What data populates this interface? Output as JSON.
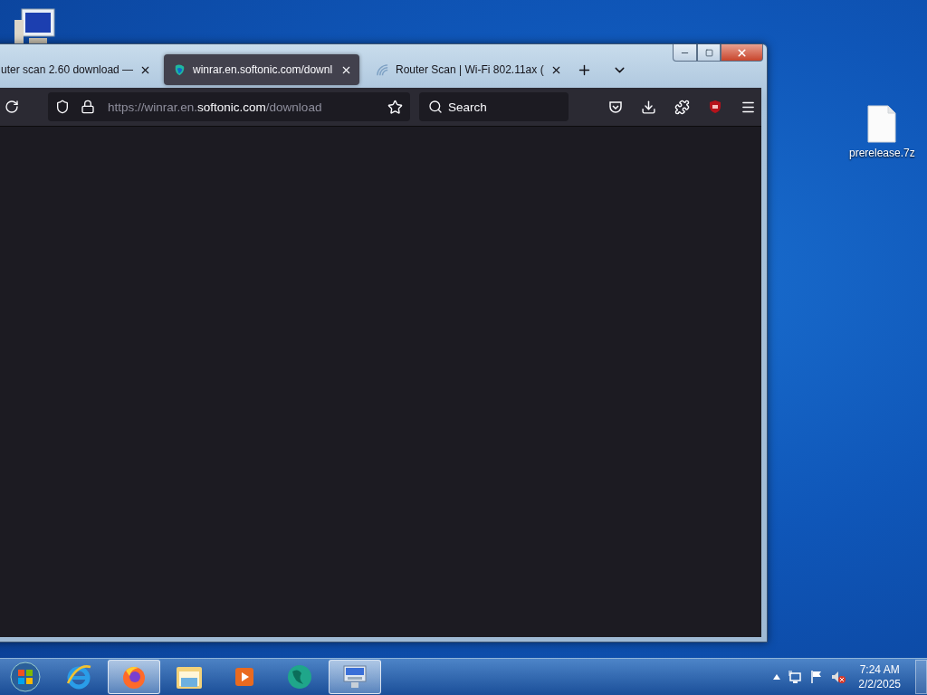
{
  "desktop_icons": [
    {
      "kind": "computer"
    },
    {
      "kind": "file",
      "label": "prerelease.7z"
    }
  ],
  "browser": {
    "tabs": [
      {
        "title": "uter scan 2.60 download —",
        "selected": false,
        "kind": "plain"
      },
      {
        "title": "winrar.en.softonic.com/downl",
        "selected": true,
        "kind": "softonic"
      },
      {
        "title": "Router Scan | Wi-Fi 802.11ax (",
        "selected": false,
        "kind": "wifi"
      }
    ],
    "address": {
      "parts": [
        {
          "text": "https://winrar.en.",
          "highlight": false
        },
        {
          "text": "softonic.com",
          "highlight": true
        },
        {
          "text": "/download",
          "highlight": false
        }
      ]
    },
    "search": {
      "placeholder": "Search"
    }
  },
  "taskbar": {
    "items": [
      {
        "kind": "ie",
        "active": false
      },
      {
        "kind": "firefox",
        "active": true
      },
      {
        "kind": "explorer",
        "active": false
      },
      {
        "kind": "media",
        "active": false
      },
      {
        "kind": "globe",
        "active": false
      },
      {
        "kind": "remote",
        "active": true
      }
    ],
    "tray": {
      "volume_muted": true,
      "time": "7:24 AM",
      "date": "2/2/2025"
    }
  }
}
